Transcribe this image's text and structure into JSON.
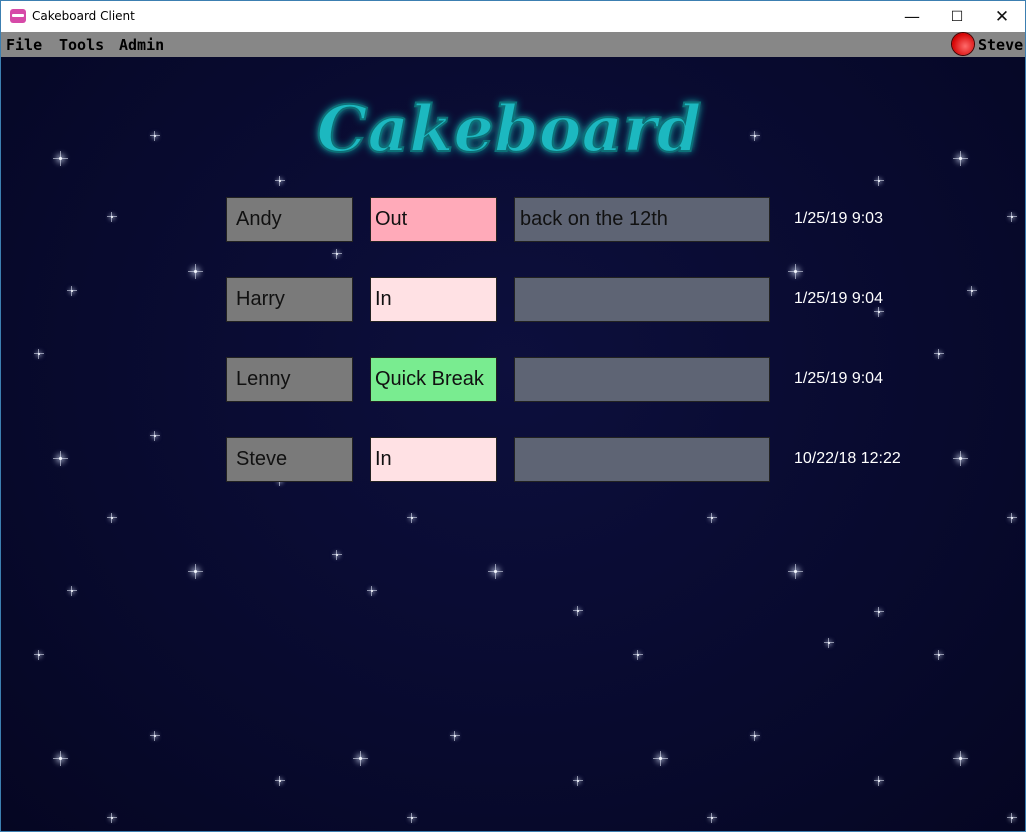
{
  "window": {
    "title": "Cakeboard Client"
  },
  "menu": {
    "items": [
      "File",
      "Tools",
      "Admin"
    ]
  },
  "current_user": {
    "name": "Steve",
    "status_color": "#d40000"
  },
  "logo": {
    "text": "Cakeboard"
  },
  "colors": {
    "status_out": "#ffaab9",
    "status_in": "#ffe1e4",
    "status_quick_break": "#79ec90",
    "name_box": "#7a7a7a",
    "note_box": "#5e6474",
    "logo": "#1fb8c0"
  },
  "rows": [
    {
      "name": "Andy",
      "status": "Out",
      "note": "back on the 12th",
      "updated": "1/25/19 9:03"
    },
    {
      "name": "Harry",
      "status": "In",
      "note": "",
      "updated": "1/25/19 9:04"
    },
    {
      "name": "Lenny",
      "status": "Quick Break",
      "note": "",
      "updated": "1/25/19 9:04"
    },
    {
      "name": "Steve",
      "status": "In",
      "note": "",
      "updated": "10/22/18 12:22"
    }
  ]
}
